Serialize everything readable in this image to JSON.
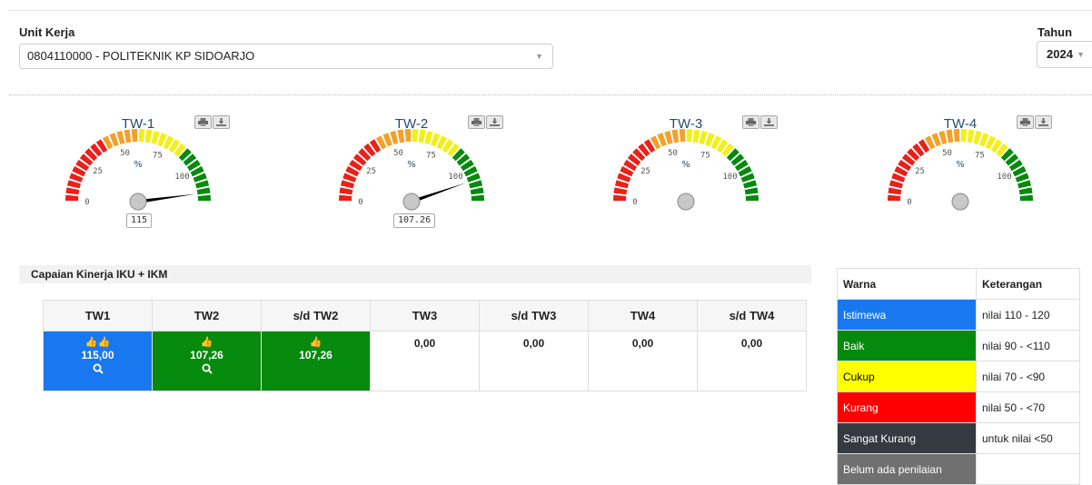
{
  "filters": {
    "unit_label": "Unit Kerja",
    "unit_value": "0804110000 - POLITEKNIK KP SIDOARJO",
    "year_label": "Tahun",
    "year_value": "2024"
  },
  "gauges": [
    {
      "title": "TW-1",
      "value": 115,
      "value_label": "115"
    },
    {
      "title": "TW-2",
      "value": 107.26,
      "value_label": "107.26"
    },
    {
      "title": "TW-3",
      "value": null,
      "value_label": ""
    },
    {
      "title": "TW-4",
      "value": null,
      "value_label": ""
    }
  ],
  "gauge_scale": {
    "min": 0,
    "max": 120,
    "ticks": [
      "0",
      "25",
      "50",
      "75",
      "100"
    ],
    "unit": "%"
  },
  "colors": {
    "red": "#e8211a",
    "orange": "#f2a12b",
    "yellow": "#f4ef17",
    "green": "#068a0e",
    "blue": "#1978f0",
    "dark": "#353a40",
    "gray": "#707070"
  },
  "section_title": "Capaian Kinerja IKU + IKM",
  "table": {
    "headers": [
      "TW1",
      "TW2",
      "s/d TW2",
      "TW3",
      "s/d TW3",
      "TW4",
      "s/d TW4"
    ],
    "cells": [
      {
        "thumbs": "👍👍",
        "value": "115,00",
        "search": true,
        "color": "blue"
      },
      {
        "thumbs": "👍",
        "value": "107,26",
        "search": true,
        "color": "green"
      },
      {
        "thumbs": "👍",
        "value": "107,26",
        "search": false,
        "color": "green"
      },
      {
        "thumbs": "",
        "value": "0,00",
        "search": false,
        "color": ""
      },
      {
        "thumbs": "",
        "value": "0,00",
        "search": false,
        "color": ""
      },
      {
        "thumbs": "",
        "value": "0,00",
        "search": false,
        "color": ""
      },
      {
        "thumbs": "",
        "value": "0,00",
        "search": false,
        "color": ""
      }
    ]
  },
  "legend": {
    "headers": [
      "Warna",
      "Keterangan"
    ],
    "rows": [
      {
        "name": "Istimewa",
        "desc": "nilai 110 - 120",
        "color": "#1978f0",
        "text_color": "#ffffff"
      },
      {
        "name": "Baik",
        "desc": "nilai 90 - <110",
        "color": "#068a0e",
        "text_color": "#ffffff"
      },
      {
        "name": "Cukup",
        "desc": "nilai 70 - <90",
        "color": "#ffff00",
        "text_color": "#000000"
      },
      {
        "name": "Kurang",
        "desc": "nilai 50 - <70",
        "color": "#ff0000",
        "text_color": "#ffffff"
      },
      {
        "name": "Sangat Kurang",
        "desc": "untuk nilai <50",
        "color": "#353a40",
        "text_color": "#ffffff"
      },
      {
        "name": "Belum ada penilaian",
        "desc": "",
        "color": "#707070",
        "text_color": "#ffffff"
      }
    ]
  }
}
